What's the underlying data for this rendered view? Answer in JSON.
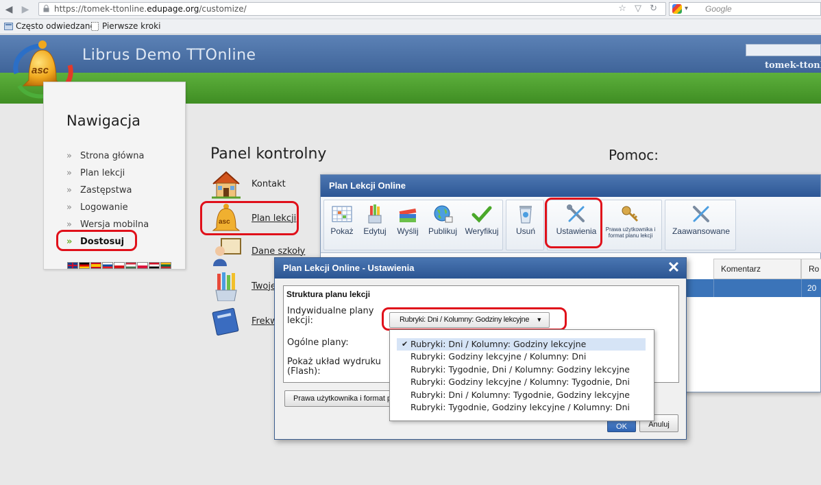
{
  "browser": {
    "url_prefix": "https://tomek-ttonline.",
    "url_host": "edupage.org",
    "url_path": "/customize/",
    "search_placeholder": "Google",
    "bookmarks": [
      "Często odwiedzane",
      "Pierwsze kroki"
    ]
  },
  "site": {
    "title": "Librus Demo TTOnline",
    "user": "tomek-ttonline",
    "accent_blue": "#3f6499",
    "accent_green": "#4a9b2c"
  },
  "nav": {
    "title": "Nawigacja",
    "items": [
      {
        "label": "Strona główna"
      },
      {
        "label": "Plan lekcji"
      },
      {
        "label": "Zastępstwa"
      },
      {
        "label": "Logowanie"
      },
      {
        "label": "Wersja mobilna"
      },
      {
        "label": "Dostosuj",
        "active": true
      }
    ]
  },
  "panel": {
    "title": "Panel kontrolny",
    "help_title": "Pomoc:",
    "items": [
      {
        "label": "Kontakt"
      },
      {
        "label": "Plan lekcji"
      },
      {
        "label": "Dane szkoły"
      },
      {
        "label": "Twoje"
      },
      {
        "label": "Frekw"
      }
    ]
  },
  "main_window": {
    "title": "Plan Lekcji Online",
    "toolbar": {
      "show": "Pokaż",
      "edit": "Edytuj",
      "send": "Wyślij",
      "publish": "Publikuj",
      "verify": "Weryfikuj",
      "delete": "Usuń",
      "settings": "Ustawienia",
      "rights": "Prawa użytkownika i format planu lekcji",
      "advanced": "Zaawansowane"
    },
    "grid": {
      "col_comment": "Komentarz",
      "col_ro": "Ro",
      "row_value": "20"
    }
  },
  "settings_dialog": {
    "title": "Plan Lekcji Online - Ustawienia",
    "close": "✕",
    "section": "Struktura planu lekcji",
    "individual_label": "Indywidualne plany lekcji:",
    "general_label": "Ogólne plany:",
    "print_label": "Pokaż układ wydruku (Flash):",
    "selected": "Rubryki: Dni / Kolumny: Godziny lekcyjne",
    "options": [
      "Rubryki: Dni / Kolumny: Godziny lekcyjne",
      "Rubryki: Godziny lekcyjne / Kolumny: Dni",
      "Rubryki: Tygodnie, Dni / Kolumny: Godziny lekcyjne",
      "Rubryki: Godziny lekcyjne / Kolumny: Tygodnie, Dni",
      "Rubryki: Dni / Kolumny: Tygodnie, Godziny lekcyjne",
      "Rubryki: Tygodnie, Godziny lekcyjne / Kolumny: Dni"
    ],
    "rights_button": "Prawa użytkownika i format planu lekcji",
    "ok": "OK",
    "cancel": "Anuluj"
  }
}
